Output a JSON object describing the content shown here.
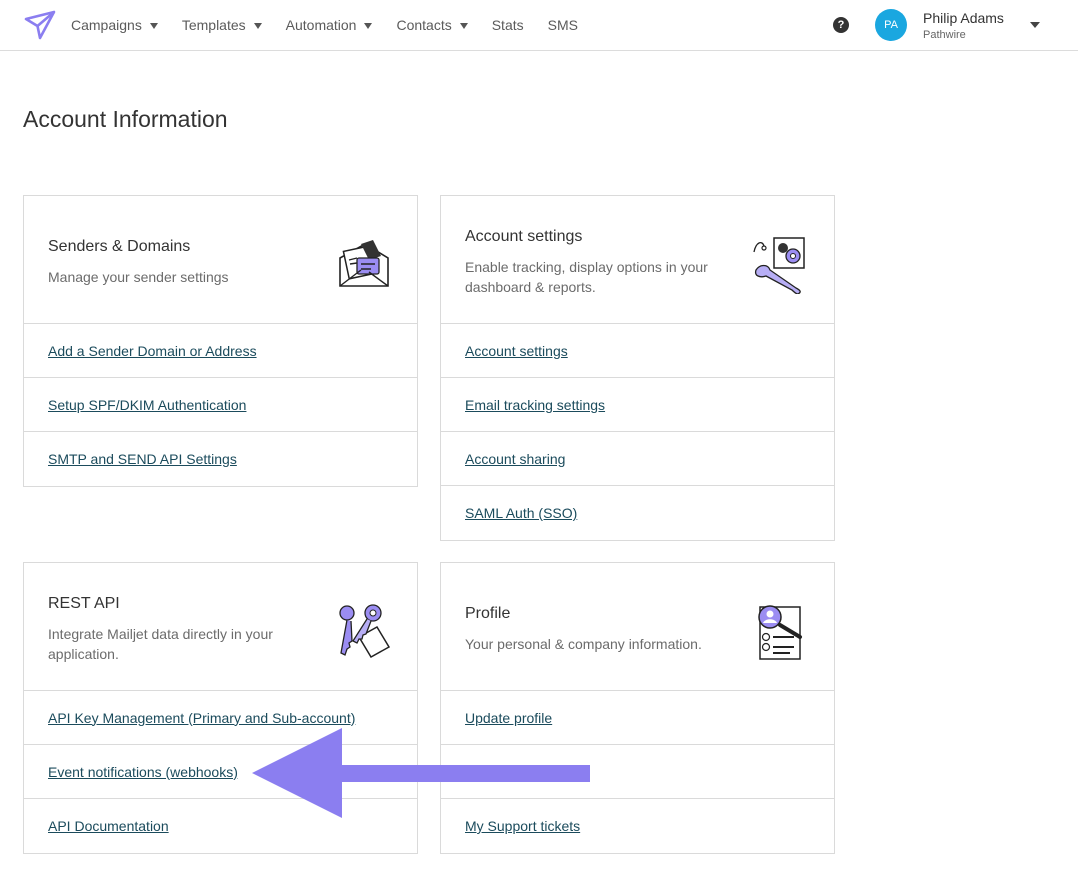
{
  "header": {
    "nav": [
      {
        "label": "Campaigns",
        "caret": true
      },
      {
        "label": "Templates",
        "caret": true
      },
      {
        "label": "Automation",
        "caret": true
      },
      {
        "label": "Contacts",
        "caret": true
      },
      {
        "label": "Stats",
        "caret": false
      },
      {
        "label": "SMS",
        "caret": false
      }
    ],
    "help_glyph": "?",
    "user": {
      "initials": "PA",
      "name": "Philip Adams",
      "org": "Pathwire"
    }
  },
  "page_title": "Account Information",
  "cards": {
    "senders": {
      "title": "Senders & Domains",
      "desc": "Manage your sender settings",
      "icon": "envelope-icon",
      "links": [
        "Add a Sender Domain or Address",
        "Setup SPF/DKIM Authentication",
        "SMTP and SEND API Settings"
      ]
    },
    "account": {
      "title": "Account settings",
      "desc": "Enable tracking, display options in your dashboard & reports.",
      "icon": "wrench-gear-icon",
      "links": [
        "Account settings",
        "Email tracking settings",
        "Account sharing",
        "SAML Auth (SSO)"
      ]
    },
    "rest": {
      "title": "REST API",
      "desc": "Integrate Mailjet data directly in your application.",
      "icon": "keys-icon",
      "links": [
        "API Key Management (Primary and Sub-account)",
        "Event notifications (webhooks)",
        "API Documentation"
      ]
    },
    "profile": {
      "title": "Profile",
      "desc": "Your personal & company information.",
      "icon": "profile-search-icon",
      "links": [
        "Update profile",
        "",
        "My Support tickets"
      ]
    }
  },
  "colors": {
    "accent": "#8b7ef0",
    "avatar": "#1aa7e0",
    "link": "#1b4b5c"
  }
}
